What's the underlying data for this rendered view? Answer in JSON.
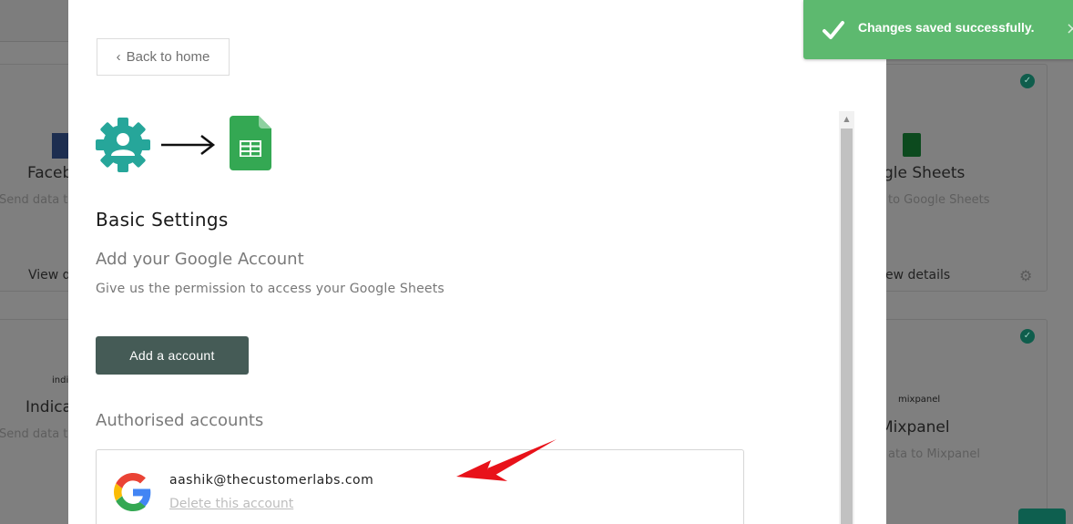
{
  "modal": {
    "back_label": "Back to home",
    "basic_settings_title": "Basic Settings",
    "add_google_title": "Add your Google Account",
    "permission_text": "Give us the permission to access your Google Sheets",
    "add_account_label": "Add a account",
    "authorised_title": "Authorised accounts",
    "accounts": [
      {
        "email": "aashik@thecustomerlabs.com",
        "delete_label": "Delete this account"
      }
    ]
  },
  "toast": {
    "message": "Changes saved successfully.",
    "close_label": "×"
  },
  "background": {
    "cards": [
      {
        "title_visible": "Faceb",
        "sub_visible": "Send data to",
        "link_visible": "View d"
      },
      {
        "title_visible": "gle Sheets",
        "sub_visible": "to Google Sheets",
        "link_visible": "ew details"
      },
      {
        "title_visible": "Indica",
        "sub_visible": "Send data to",
        "logo_text": "indica"
      },
      {
        "title_visible": "Mixpanel",
        "sub_visible": "ata to Mixpanel",
        "logo_text": "mixpanel"
      }
    ]
  },
  "icons": {
    "gear": "user-gear-icon",
    "arrow": "right-arrow-icon",
    "sheets": "google-sheets-icon",
    "google": "google-logo-icon",
    "annotation": "red-arrow-annotation",
    "check": "check-icon"
  },
  "colors": {
    "teal": "#26a69a",
    "sheets_green": "#34a853",
    "add_button": "#455b56",
    "toast_bg": "#5db96f",
    "annotation_red": "#e8121a"
  }
}
